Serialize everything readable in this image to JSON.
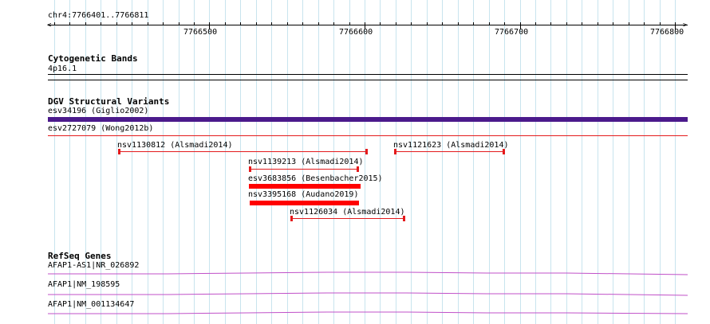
{
  "header": {
    "region": "chr4:7766401..7766811"
  },
  "ruler": {
    "labels": [
      "7766500",
      "7766600",
      "7766700",
      "7766800"
    ]
  },
  "cytoband": {
    "title": "Cytogenetic Bands",
    "band": "4p16.1"
  },
  "dgv": {
    "title": "DGV Structural Variants",
    "items": [
      {
        "label": "esv34196 (Giglio2002)",
        "color": "#4b1a8c"
      },
      {
        "label": "esv2727079 (Wong2012b)",
        "color": "#e41a1c"
      },
      {
        "label": "nsv1130812 (Alsmadi2014)",
        "color": "#e41a1c"
      },
      {
        "label": "nsv1121623 (Alsmadi2014)",
        "color": "#e41a1c"
      },
      {
        "label": "nsv1139213 (Alsmadi2014)",
        "color": "#e41a1c"
      },
      {
        "label": "esv3683856 (Besenbacher2015)",
        "color": "#ff0000"
      },
      {
        "label": "nsv3395168 (Audano2019)",
        "color": "#ff0000"
      },
      {
        "label": "nsv1126034 (Alsmadi2014)",
        "color": "#e41a1c"
      }
    ]
  },
  "refseq": {
    "title": "RefSeq Genes",
    "color": "#c050c8",
    "items": [
      {
        "label": "AFAP1-AS1|NR_026892"
      },
      {
        "label": "AFAP1|NM_198595"
      },
      {
        "label": "AFAP1|NM_001134647"
      }
    ]
  }
}
